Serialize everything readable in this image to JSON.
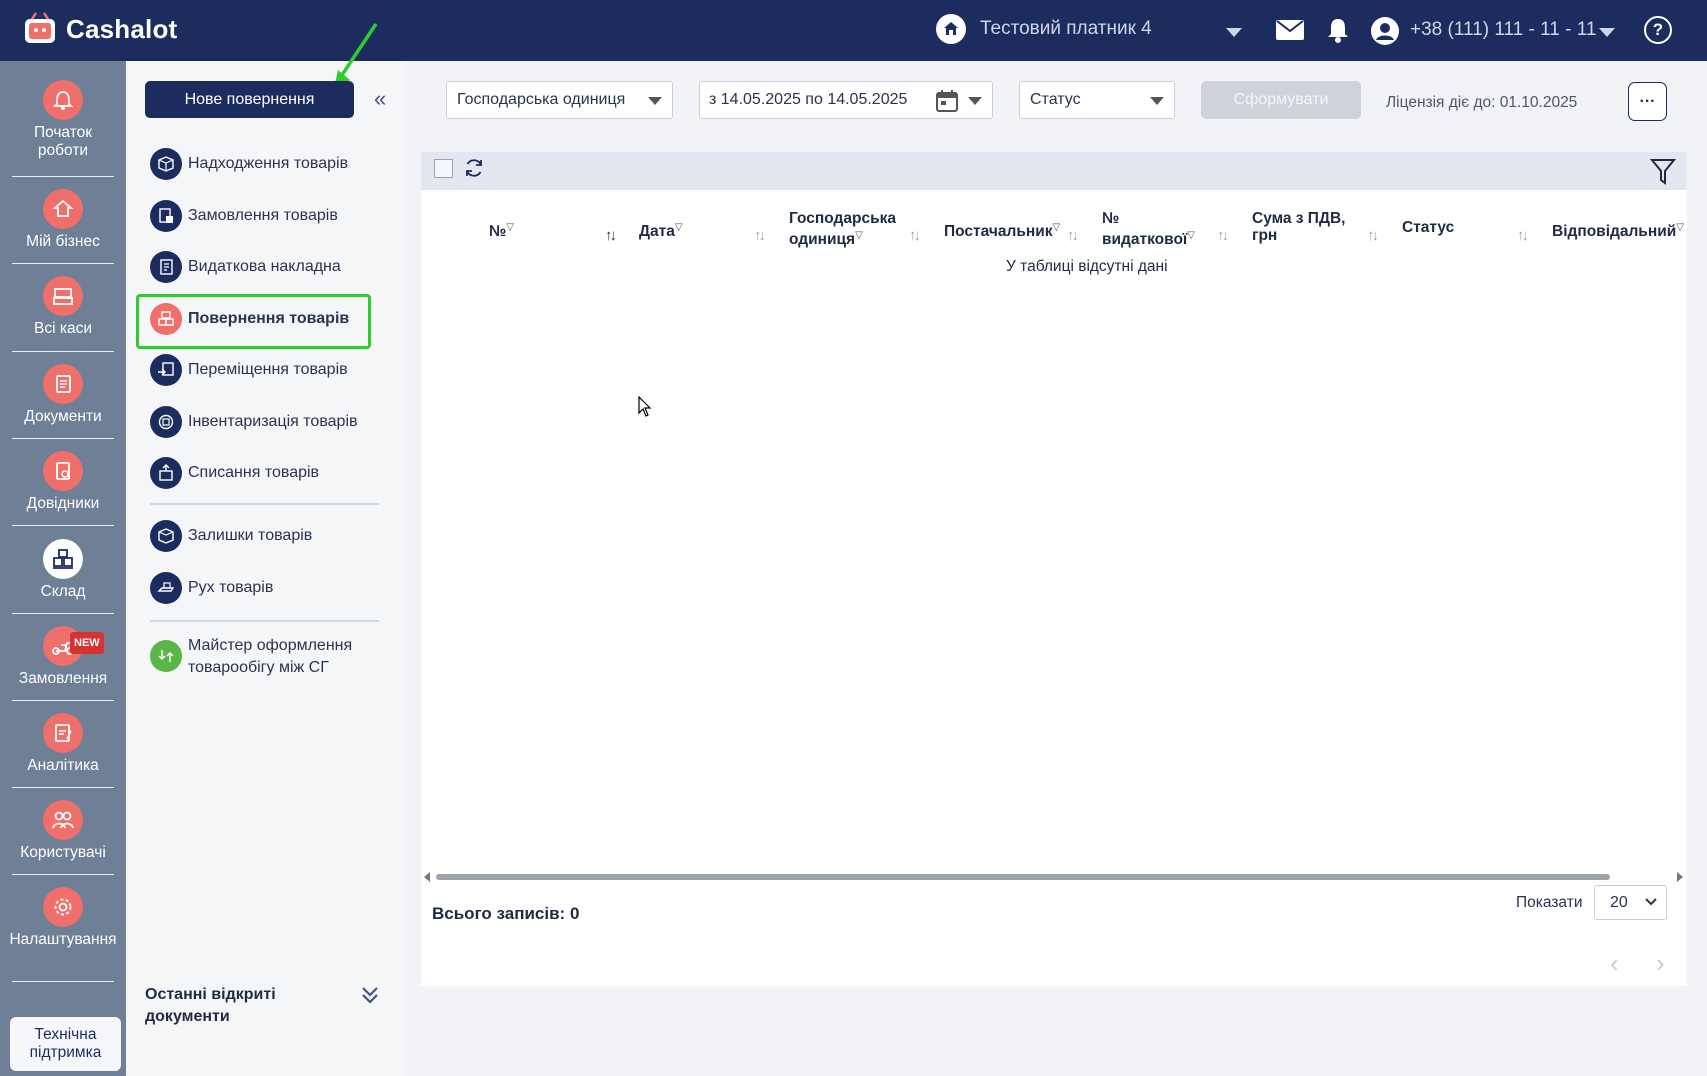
{
  "app": {
    "logo_text": "Cashalot"
  },
  "header": {
    "payer_name": "Тестовий платник 4",
    "phone": "+38 (111) 111 - 11 - 11",
    "help_label": "?"
  },
  "rail": {
    "items": [
      {
        "label": "Початок роботи",
        "icon": "bell-icon"
      },
      {
        "label": "Мій бізнес",
        "icon": "home-icon"
      },
      {
        "label": "Всі каси",
        "icon": "cash-register-icon"
      },
      {
        "label": "Документи",
        "icon": "documents-icon"
      },
      {
        "label": "Довідники",
        "icon": "reference-book-icon"
      },
      {
        "label": "Склад",
        "icon": "warehouse-icon",
        "active": true
      },
      {
        "label": "Замовлення",
        "icon": "scooter-icon",
        "badge": "NEW"
      },
      {
        "label": "Аналітика",
        "icon": "analytics-icon"
      },
      {
        "label": "Користувачі",
        "icon": "users-icon"
      },
      {
        "label": "Налаштування",
        "icon": "gear-icon"
      }
    ],
    "support_label": "Технічна підтримка"
  },
  "submenu": {
    "new_button": "Нове повернення",
    "items": [
      {
        "label": "Надходження товарів",
        "icon": "receipt-box-icon"
      },
      {
        "label": "Замовлення товарів",
        "icon": "order-icon"
      },
      {
        "label": "Видаткова накладна",
        "icon": "invoice-icon"
      },
      {
        "label": "Повернення товарів",
        "icon": "return-boxes-icon",
        "active": true
      },
      {
        "label": "Переміщення товарів",
        "icon": "transfer-icon"
      },
      {
        "label": "Інвентаризація товарів",
        "icon": "inventory-icon"
      },
      {
        "label": "Списання товарів",
        "icon": "write-off-icon"
      },
      {
        "label": "Залишки товарів",
        "icon": "stock-box-icon"
      },
      {
        "label": "Рух товарів",
        "icon": "goods-movement-icon"
      },
      {
        "label": "Майстер оформлення товарообігу між СГ",
        "icon": "wizard-icon"
      }
    ],
    "recent_docs_label": "Останні відкриті документи"
  },
  "filters": {
    "unit_select": "Господарська одиниця",
    "date_range": "з 14.05.2025 по 14.05.2025",
    "status_select": "Статус",
    "form_button": "Сформувати",
    "license": "Ліцензія діє до: 01.10.2025",
    "more_button": "···"
  },
  "table": {
    "columns": [
      {
        "label": "№"
      },
      {
        "label": "Дата"
      },
      {
        "label": "Господарська одиниця"
      },
      {
        "label": "Постачальник"
      },
      {
        "label": "№ видаткової"
      },
      {
        "label": "Сума з ПДВ, грн"
      },
      {
        "label": "Статус"
      },
      {
        "label": "Відповідальний"
      }
    ],
    "empty_text": "У таблиці відсутні дані",
    "total_label": "Всього записів: 0",
    "show_label": "Показати",
    "page_size": "20",
    "prev_label": "‹",
    "next_label": "›"
  },
  "colors": {
    "navy": "#1d2c5e",
    "rail": "#6e7f96",
    "accent_red": "#ef6f6a",
    "highlight_green": "#2ecc2e"
  }
}
